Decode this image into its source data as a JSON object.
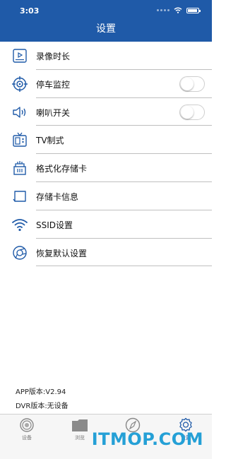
{
  "status_bar": {
    "time": "3:03"
  },
  "header": {
    "title": "设置"
  },
  "menu": [
    {
      "label": "录像时长",
      "icon": "video-duration-icon"
    },
    {
      "label": "停车监控",
      "icon": "crosshair-target-icon",
      "toggle": false
    },
    {
      "label": "喇叭开关",
      "icon": "speaker-icon",
      "toggle": false
    },
    {
      "label": "TV制式",
      "icon": "tv-icon"
    },
    {
      "label": "格式化存储卡",
      "icon": "format-card-icon"
    },
    {
      "label": "存储卡信息",
      "icon": "sd-card-icon"
    },
    {
      "label": "SSID设置",
      "icon": "wifi-icon"
    },
    {
      "label": "恢复默认设置",
      "icon": "restore-icon"
    }
  ],
  "versions": {
    "app": "APP版本:V2.94",
    "dvr": "DVR版本:无设备"
  },
  "tabs": [
    {
      "label": "设备",
      "icon": "camera-lens-icon"
    },
    {
      "label": "浏览",
      "icon": "folder-icon"
    },
    {
      "label": "",
      "icon": "compass-icon"
    },
    {
      "label": "设置",
      "icon": "settings-gear-icon",
      "active": true
    }
  ],
  "watermark": "ITMOP.COM",
  "colors": {
    "accent": "#1f5aa8",
    "watermark": "#25a0d6"
  }
}
